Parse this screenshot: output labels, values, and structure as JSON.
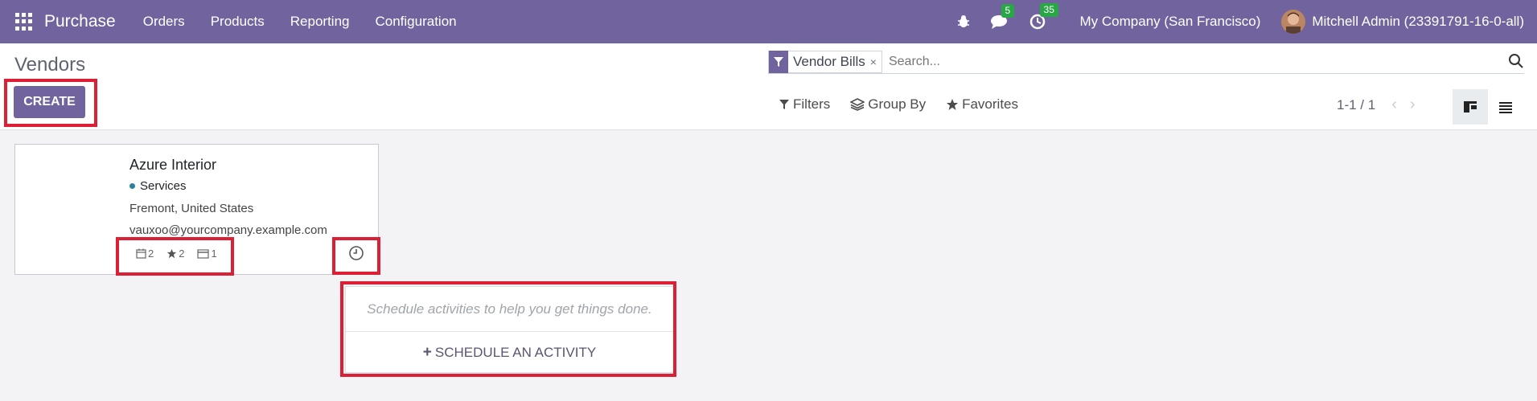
{
  "navbar": {
    "app_name": "Purchase",
    "menu": [
      "Orders",
      "Products",
      "Reporting",
      "Configuration"
    ],
    "messages_count": "5",
    "activities_count": "35",
    "company": "My Company (San Francisco)",
    "user": "Mitchell Admin (23391791-16-0-all)",
    "bg_color": "#71639e"
  },
  "control_panel": {
    "title": "Vendors",
    "create_label": "CREATE",
    "search": {
      "facet_label": "Vendor Bills",
      "facet_close": "×",
      "placeholder": "Search..."
    },
    "filters_label": "Filters",
    "groupby_label": "Group By",
    "favorites_label": "Favorites",
    "pager": "1-1 / 1"
  },
  "card": {
    "name": "Azure Interior",
    "tag": "Services",
    "address": "Fremont, United States",
    "email": "vauxoo@yourcompany.example.com",
    "stats": {
      "meetings": "2",
      "favorites": "2",
      "bills": "1"
    }
  },
  "activity_popover": {
    "hint": "Schedule activities to help you get things done.",
    "button_label": "SCHEDULE AN ACTIVITY"
  },
  "colors": {
    "accent": "#71639e",
    "highlight": "#dc1f35",
    "badge": "#28a745"
  }
}
